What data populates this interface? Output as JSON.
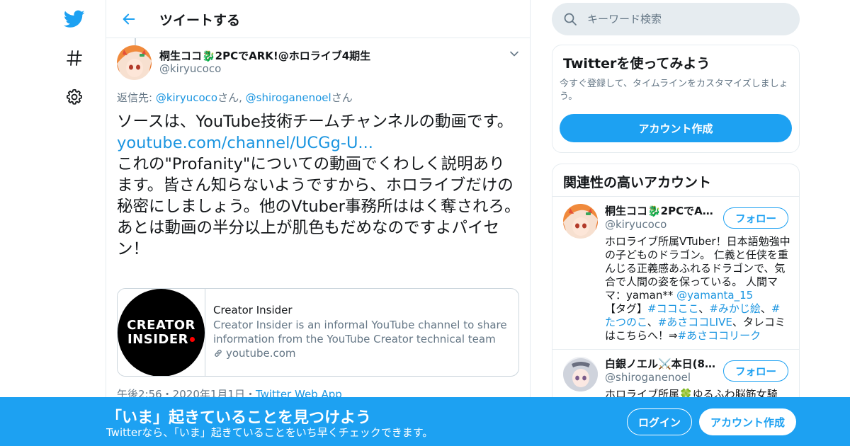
{
  "nav": {
    "items": [
      {
        "icon": "twitter-bird-icon"
      },
      {
        "icon": "hashtag-icon"
      },
      {
        "icon": "gear-icon"
      }
    ]
  },
  "header": {
    "title": "ツイートする"
  },
  "tweet": {
    "author_name": "桐生ココ🐉2PCでARK!@ホロライブ4期生",
    "author_handle": "@kiryucoco",
    "reply_prefix": "返信先: ",
    "reply_user1": "@kiryucoco",
    "reply_sep1": "さん, ",
    "reply_user2": "@shiroganenoel",
    "reply_sep2": "さん",
    "text_part1": "ソースは、YouTube技術チームチャンネルの動画です。",
    "link": "youtube.com/channel/UCGg-U...",
    "text_part2": "これの\"Profanity\"についての動画でくわしく説明あります。皆さん知らないようですから、ホロライブだけの秘密にしましょう。他のVtuber事務所ははく奪されろ。あとは動画の半分以上が肌色もだめなのですよパイセン！",
    "timestamp": "午後2:56・2020年1月1日・",
    "source": "Twitter Web App"
  },
  "card": {
    "logo_line1": "CREATOR",
    "logo_line2": "INSIDER",
    "title": "Creator Insider",
    "description": "Creator Insider is an informal YouTube channel to share information from the YouTube Creator technical team with the...",
    "domain": "youtube.com"
  },
  "search": {
    "placeholder": "キーワード検索"
  },
  "try_box": {
    "title": "Twitterを使ってみよう",
    "description": "今すぐ登録して、タイムラインをカスタマイズしましょう。",
    "button": "アカウント作成"
  },
  "related": {
    "title": "関連性の高いアカウント",
    "accounts": [
      {
        "name": "桐生ココ🐉2PCでARK!@ホロライブ4期生",
        "name_display": "桐生ココ🐉2PCでAR...",
        "handle": "@kiryucoco",
        "follow": "フォロー",
        "bio_part1": "ホロライブ所属VTuber！日本語勉強中の子どものドラゴン。 仁義と任侠を重んじる正義感あふれるドラゴンで、気合で人間の姿を保っている。 人間ママ：yaman** ",
        "bio_link1": "@yamanta_15",
        "bio_part2": "【タグ】",
        "bio_tag1": "#ココここ",
        "bio_sep1": "、",
        "bio_tag2": "#みかじ絵",
        "bio_sep2": "、",
        "bio_tag3": "#たつのこ",
        "bio_sep3": "、",
        "bio_tag4": "#あさココLIVE",
        "bio_part3": "、タレコミはこちらへ！⇒",
        "bio_tag5": "#あさココリーク"
      },
      {
        "name": "白銀ノエル⚔️本日(8/...",
        "handle": "@shiroganenoel",
        "follow": "フォロー",
        "bio_part1": "ホロライブ所属🍀ゆるふわ脳筋女騎"
      }
    ]
  },
  "banner": {
    "title": "「いま」起きていることを見つけよう",
    "subtitle": "Twitterなら、「いま」起きていることをいち早くチェックできます。",
    "login": "ログイン",
    "signup": "アカウント作成"
  },
  "colors": {
    "brand": "#1da1f2",
    "link": "#1b95e0",
    "muted": "#657786",
    "border": "#e6ecf0"
  }
}
